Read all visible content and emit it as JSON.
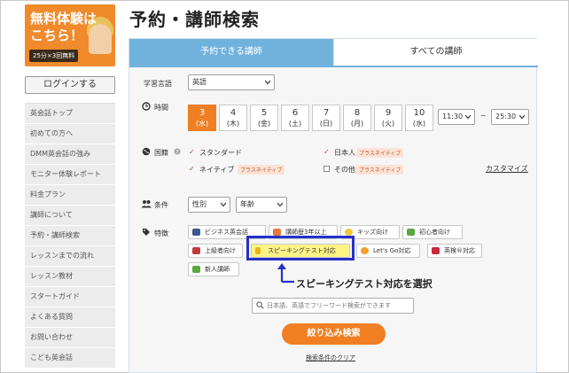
{
  "banner": {
    "line1": "無料体験は",
    "line2": "こちら！",
    "line3": "25分×3回無料"
  },
  "login_label": "ログインする",
  "side_nav": [
    "英会話トップ",
    "初めての方へ",
    "DMM英会話の強み",
    "モニター体験レポート",
    "料金プラン",
    "講師について",
    "予約・講師検索",
    "レッスンまでの流れ",
    "レッスン教材",
    "スタートガイド",
    "よくある質問",
    "お問い合わせ",
    "こども英会話"
  ],
  "page_title": "予約・講師検索",
  "tabs": {
    "available": "予約できる講師",
    "all": "すべての講師"
  },
  "language": {
    "label": "学習言語",
    "value": "英語"
  },
  "time": {
    "label": "時間",
    "dates": [
      {
        "day": "3",
        "dow": "(水)"
      },
      {
        "day": "4",
        "dow": "(木)"
      },
      {
        "day": "5",
        "dow": "(金)"
      },
      {
        "day": "6",
        "dow": "(土)"
      },
      {
        "day": "7",
        "dow": "(日)"
      },
      {
        "day": "8",
        "dow": "(月)"
      },
      {
        "day": "9",
        "dow": "(火)"
      },
      {
        "day": "10",
        "dow": "(水)"
      }
    ],
    "from": "11:30",
    "tilde": "~",
    "to": "25:30"
  },
  "nationality": {
    "label": "国籍",
    "standard": "スタンダード",
    "native": "ネイティブ",
    "japanese": "日本人",
    "other": "その他",
    "native_plus": "プラスネイティブ",
    "customize": "カスタマイズ"
  },
  "conditions": {
    "label": "条件",
    "gender": "性別",
    "age": "年齢"
  },
  "features": {
    "label": "特徴",
    "items": [
      "ビジネス英会話",
      "講師歴3年以上",
      "キッズ向け",
      "初心者向け",
      "上級者向け",
      "スピーキングテスト対応",
      "Let's Go対応",
      "英検®対応",
      "新人講師"
    ]
  },
  "annotation": "スピーキングテスト対応を選択",
  "search_placeholder": "日本語、英語でフリーワード検索ができます",
  "filter_button": "絞り込み検索",
  "clear_link": "検索条件のクリア",
  "colors": {
    "accent_orange": "#f07f23",
    "tab_blue": "#70b2dc",
    "highlight_border": "#2430c8",
    "highlight_fill": "#fff386"
  }
}
